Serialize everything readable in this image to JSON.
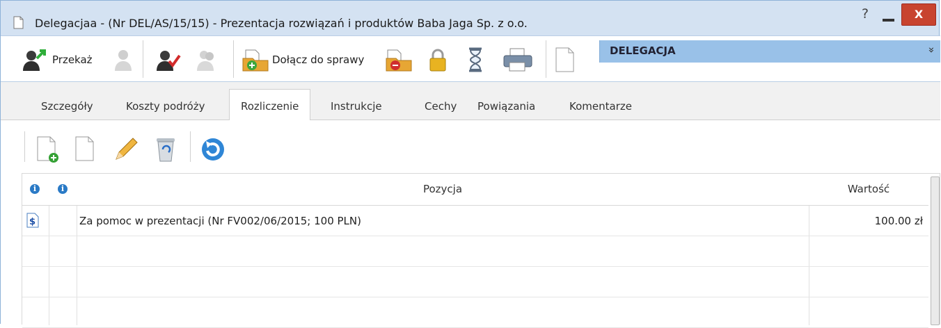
{
  "window": {
    "title": "Delegacjaa - (Nr DEL/AS/15/15) - Prezentacja rozwiązań i produktów Baba Jaga Sp. z o.o.",
    "help_glyph": "?",
    "close_glyph": "X"
  },
  "toolbar": {
    "forward_label": "Przekaż",
    "attach_label": "Dołącz do sprawy"
  },
  "panel_header": {
    "title": "DELEGACJA",
    "collapse_glyph": "»"
  },
  "tabs": [
    {
      "label": "Szczegóły",
      "active": false
    },
    {
      "label": "Koszty podróży",
      "active": false
    },
    {
      "label": "Rozliczenie",
      "active": true
    },
    {
      "label": "Instrukcje",
      "active": false
    },
    {
      "label": "Cechy",
      "active": false
    },
    {
      "label": "Powiązania",
      "active": false
    },
    {
      "label": "Komentarze",
      "active": false
    }
  ],
  "grid": {
    "info_glyph": "i",
    "columns": {
      "position": "Pozycja",
      "value": "Wartość"
    },
    "rows": [
      {
        "icon": "dollar-document-icon",
        "position": "Za pomoc w prezentacji (Nr FV002/06/2015; 100 PLN)",
        "value": "100.00 zł"
      }
    ]
  },
  "colors": {
    "title_bar": "#d4e2f2",
    "panel_header": "#99c1e8",
    "close_button": "#c8442f"
  }
}
